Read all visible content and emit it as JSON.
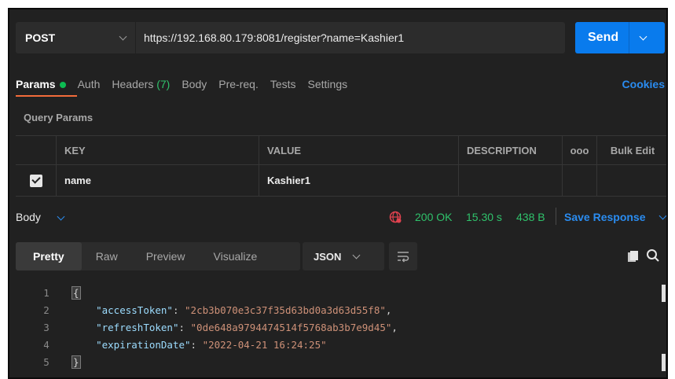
{
  "request": {
    "method": "POST",
    "url": "https://192.168.80.179:8081/register?name=Kashier1",
    "send_label": "Send"
  },
  "tabs": {
    "params": "Params",
    "auth": "Auth",
    "headers": "Headers",
    "headers_count": "(7)",
    "body": "Body",
    "prereq": "Pre-req.",
    "tests": "Tests",
    "settings": "Settings",
    "cookies": "Cookies"
  },
  "query_params": {
    "label": "Query Params",
    "columns": {
      "key": "KEY",
      "value": "VALUE",
      "description": "DESCRIPTION",
      "more": "ooo",
      "bulk_edit": "Bulk Edit"
    },
    "rows": [
      {
        "checked": true,
        "key": "name",
        "value": "Kashier1",
        "description": ""
      }
    ]
  },
  "response": {
    "body_label": "Body",
    "status": "200 OK",
    "time": "15.30 s",
    "size": "438 B",
    "save_label": "Save Response"
  },
  "view": {
    "tabs": [
      "Pretty",
      "Raw",
      "Preview",
      "Visualize"
    ],
    "active": "Pretty",
    "format": "JSON"
  },
  "code": {
    "line_numbers": [
      "1",
      "2",
      "3",
      "4",
      "5"
    ],
    "open_brace": "{",
    "close_brace": "}",
    "fields": [
      {
        "key": "\"accessToken\"",
        "value": "\"2cb3b070e3c37f35d63bd0a3d63d55f8\"",
        "trail": ","
      },
      {
        "key": "\"refreshToken\"",
        "value": "\"0de648a9794474514f5768ab3b7e9d45\"",
        "trail": ","
      },
      {
        "key": "\"expirationDate\"",
        "value": "\"2022-04-21 16:24:25\"",
        "trail": ""
      }
    ]
  },
  "colors": {
    "background": "#212121",
    "accent_blue": "#097bed",
    "link_blue": "#2a8cf0",
    "status_green": "#2fc26b",
    "tab_underline": "#f26b3a"
  },
  "icons": {
    "method_dropdown": "chevron-down-icon",
    "send_dropdown": "chevron-down-icon",
    "params_indicator": "green-dot-icon",
    "network": "globe-icon",
    "wrap": "wrap-lines-icon",
    "copy": "copy-icon",
    "search": "search-icon"
  }
}
